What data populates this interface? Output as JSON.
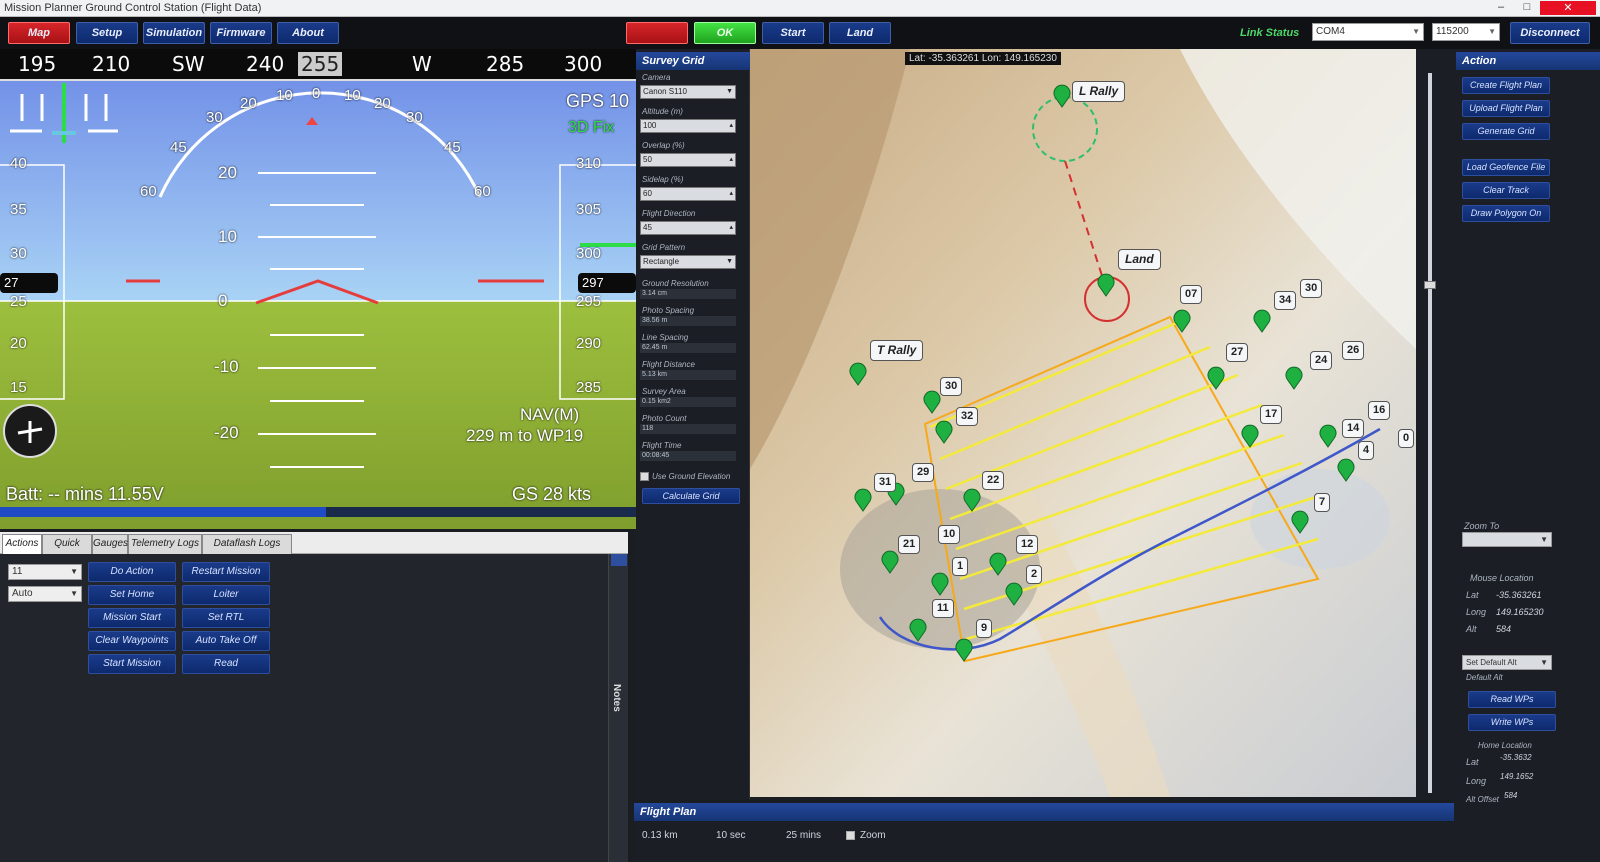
{
  "window": {
    "title": "Mission Planner Ground Control Station (Flight Data)"
  },
  "toolbar": {
    "buttons": [
      "Map",
      "Setup",
      "Simulation",
      "Firmware",
      "About"
    ],
    "status_buttons": [
      "",
      "OK"
    ],
    "right_buttons": [
      "Start",
      "Land"
    ],
    "connect_status": "Link Status",
    "port_value": "COM4",
    "baud_value": "115200",
    "connect_label": "Disconnect"
  },
  "hud": {
    "heading_ticks": [
      "195",
      "210",
      "SW",
      "240",
      "255",
      "W",
      "285",
      "300"
    ],
    "heading_current": "255",
    "roll_marks": [
      "60",
      "45",
      "30",
      "20",
      "10",
      "0",
      "10",
      "20",
      "30",
      "45",
      "60"
    ],
    "pitch_labels": [
      "20",
      "10",
      "0",
      "-10",
      "-20"
    ],
    "left_tape": [
      "40",
      "35",
      "30",
      "27",
      "25",
      "20",
      "15"
    ],
    "right_tape": [
      "310",
      "305",
      "300",
      "297",
      "295",
      "290",
      "285"
    ],
    "gps": "GPS 10",
    "fix": "3D Fix",
    "nav_mode": "NAV(M)",
    "wp_info": "229 m to WP19",
    "battery": "Batt: -- mins  11.55V",
    "ground_speed": "GS 28 kts",
    "horizon_fraction": 0.5
  },
  "actions_panel": {
    "tabs": [
      "Actions",
      "Quick",
      "Gauges",
      "Telemetry Logs",
      "Dataflash Logs"
    ],
    "dropdowns": [
      "11",
      "Auto"
    ],
    "buttons_left": [
      "Do Action",
      "Set Home",
      "Mission Start",
      "Clear Waypoints",
      "Start Mission"
    ],
    "buttons_right": [
      "Restart Mission",
      "Loiter",
      "Set RTL",
      "Auto Take Off",
      "Read"
    ],
    "side_label": "Notes"
  },
  "survey": {
    "title": "Survey Grid",
    "fields": [
      {
        "label": "Camera",
        "value": "Canon S110",
        "type": "combo"
      },
      {
        "label": "Altitude (m)",
        "value": "100",
        "type": "spin"
      },
      {
        "label": "Overlap (%)",
        "value": "50",
        "type": "spin"
      },
      {
        "label": "Sidelap (%)",
        "value": "60",
        "type": "spin"
      },
      {
        "label": "Flight Direction",
        "value": "45",
        "type": "spin"
      },
      {
        "label": "Grid Pattern",
        "value": "Rectangle",
        "type": "combo"
      }
    ],
    "readouts": [
      {
        "label": "Ground Resolution",
        "value": "3.14 cm"
      },
      {
        "label": "Photo Spacing",
        "value": "38.56 m"
      },
      {
        "label": "Line Spacing",
        "value": "62.45 m"
      },
      {
        "label": "Flight Distance",
        "value": "5.13 km"
      },
      {
        "label": "Survey Area",
        "value": "0.15 km2"
      },
      {
        "label": "Photo Count",
        "value": "118"
      },
      {
        "label": "Flight Time",
        "value": "00:08:45"
      }
    ],
    "checkbox_label": "Use Ground Elevation",
    "calc_button": "Calculate Grid"
  },
  "map": {
    "header": "Lat: -35.363261  Lon: 149.165230",
    "labels": [
      {
        "text": "L Rally"
      },
      {
        "text": "Land"
      },
      {
        "text": "T Rally"
      }
    ],
    "waypoint_labels": [
      "07",
      "34",
      "30",
      "27",
      "24",
      "26",
      "17",
      "14",
      "16",
      "0",
      "4",
      "7",
      "30",
      "32",
      "29",
      "31",
      "22",
      "10",
      "21",
      "1",
      "12",
      "2",
      "11",
      "9"
    ]
  },
  "action_panel": {
    "title": "Action",
    "buttons_top": [
      "Create Flight Plan",
      "Upload Flight Plan",
      "Generate Grid"
    ],
    "buttons_mid": [
      "Load Geofence File",
      "Clear Track",
      "Draw Polygon On"
    ],
    "zoom_label": "Zoom To",
    "mouse_location_title": "Mouse Location",
    "lat_label": "Lat",
    "lat_value": "-35.363261",
    "lon_label": "Long",
    "lon_value": "149.165230",
    "alt_label": "Alt",
    "alt_value": "584",
    "wp_radius_select": "Set Default Alt",
    "default_alt": "Default Alt",
    "buttons_bottom": [
      "Read WPs",
      "Write WPs"
    ],
    "home_title": "Home Location",
    "home_lat": "-35.3632",
    "home_lon": "149.1652",
    "home_alt": "584",
    "home_alt_label": "Alt Offset"
  },
  "bottom": {
    "flight_plan_title": "Flight Plan",
    "status_items": [
      "0.13 km",
      "10 sec",
      "25 mins",
      "Zoom"
    ]
  }
}
